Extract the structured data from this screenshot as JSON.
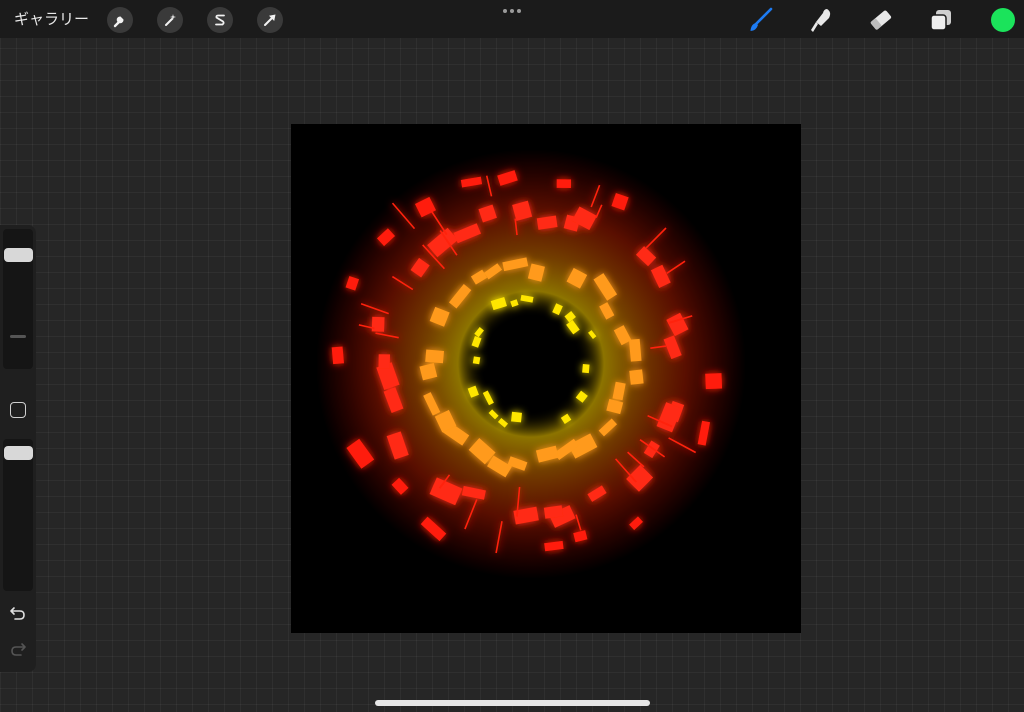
{
  "topbar": {
    "gallery_label": "ギャラリー",
    "left_tools": [
      {
        "name": "actions",
        "icon": "wrench-icon"
      },
      {
        "name": "adjustments",
        "icon": "magic-wand-icon"
      },
      {
        "name": "selection",
        "icon": "selection-s-icon"
      },
      {
        "name": "transform",
        "icon": "arrow-cursor-icon"
      }
    ],
    "more_icon": "more-dots-icon",
    "right_tools": [
      {
        "name": "brush",
        "icon": "brush-icon",
        "active": true
      },
      {
        "name": "smudge",
        "icon": "smudge-finger-icon"
      },
      {
        "name": "eraser",
        "icon": "eraser-icon"
      },
      {
        "name": "layers",
        "icon": "layers-icon"
      }
    ],
    "current_color": "#1be35b"
  },
  "sidebar": {
    "brush_size_level": 0.85,
    "opacity_level": 0.95,
    "undo_icon": "undo-icon",
    "redo_icon": "redo-icon",
    "modify_icon": "square-modify-icon"
  },
  "canvas": {
    "background": "#000000",
    "artwork": "radial-burst-neon",
    "beam_color": "#2ee6c2"
  }
}
